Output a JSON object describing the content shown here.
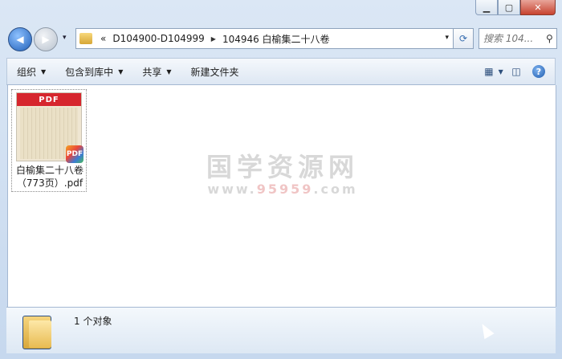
{
  "window": {
    "minimize": "▁",
    "maximize": "▢",
    "close": "✕"
  },
  "navigation": {
    "back_icon": "arrow-left",
    "forward_icon": "arrow-right",
    "history_drop": "▾"
  },
  "address": {
    "chevron": "«",
    "crumbs": [
      "D104900-D104999",
      "104946 白榆集二十八卷"
    ],
    "separator": "▶"
  },
  "search": {
    "placeholder": "搜索 104..."
  },
  "toolbar": {
    "organize": "组织",
    "include_in_library": "包含到库中",
    "share": "共享",
    "new_folder": "新建文件夹"
  },
  "files": [
    {
      "name_line1": "白榆集二十八卷",
      "name_line2": "（773页）.pdf",
      "thumb_header": "PDF",
      "badge": "PDF"
    }
  ],
  "watermark": {
    "line1": "国学资源网",
    "line2_prefix": "www.",
    "line2_num": "95959",
    "line2_suffix": ".com"
  },
  "details": {
    "count": "1 个对象"
  },
  "colors": {
    "accent": "#3a6fb0",
    "close": "#c7432f",
    "pdf_red": "#d6262d"
  }
}
